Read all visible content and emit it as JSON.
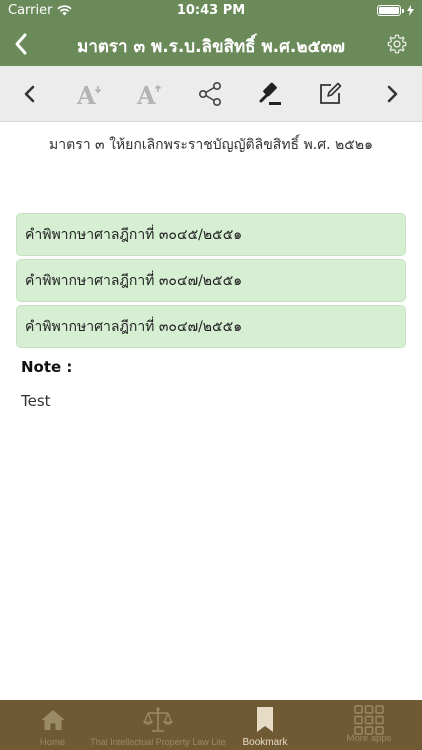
{
  "status": {
    "carrier": "Carrier",
    "time": "10:43 PM"
  },
  "nav": {
    "title": "มาตรา ๓ พ.ร.บ.ลิขสิทธิ์ พ.ศ.๒๕๓๗"
  },
  "content": {
    "section_text": "มาตรา ๓  ให้ยกเลิกพระราชบัญญัติลิขสิทธิ์ พ.ศ. ๒๕๒๑",
    "judgments": [
      "คำพิพากษาศาลฎีกาที่ ๓๐๔๕/๒๕๕๑",
      "คำพิพากษาศาลฎีกาที่ ๓๐๔๗/๒๕๕๑",
      "คำพิพากษาศาลฎีกาที่ ๓๐๔๗/๒๕๕๑"
    ],
    "note_label": "Note :",
    "note_text": "Test"
  },
  "tabs": [
    {
      "label": "Home",
      "icon": "home-icon"
    },
    {
      "label": "Thai Intellectual Property Law Lite",
      "icon": "scales-icon"
    },
    {
      "label": "Bookmark",
      "icon": "bookmark-icon",
      "active": true
    },
    {
      "label": "More apps",
      "icon": "grid-icon"
    }
  ],
  "colors": {
    "header": "#6b8a5a",
    "toolbar": "#ececec",
    "judgment_bg": "#d6efd3",
    "tabbar": "#6f5a34",
    "tab_active": "#e6dcc6",
    "tab_inactive": "#9b8a66"
  }
}
